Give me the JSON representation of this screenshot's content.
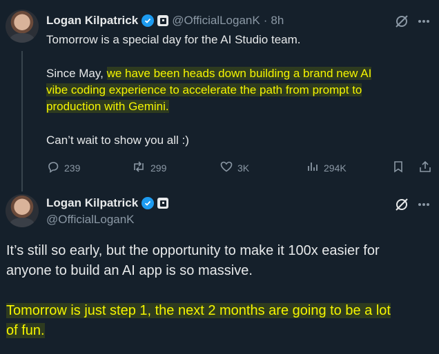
{
  "tweet1": {
    "author_name": "Logan Kilpatrick",
    "handle": "@OfficialLoganK",
    "separator": "·",
    "time": "8h",
    "paragraphs": [
      [
        "Tomorrow is a special day for the AI Studio team."
      ],
      [
        "Since May, ",
        "we have been heads down building a brand new AI"
      ],
      [
        "vibe coding experience to accelerate the path from prompt to"
      ],
      [
        "production with Gemini."
      ],
      [
        "Can’t wait to show you all :)"
      ]
    ],
    "stats": {
      "replies": "239",
      "reposts": "299",
      "likes": "3K",
      "views": "294K"
    }
  },
  "tweet2": {
    "author_name": "Logan Kilpatrick",
    "handle": "@OfficialLoganK",
    "lines": [
      "It’s still so early, but the opportunity to make it 100x easier for",
      "anyone to build an AI app is so massive.",
      "Tomorrow is just step 1, the next 2 months are going to be a lot",
      "of fun."
    ]
  },
  "icons": {
    "verified": "verified-badge-icon",
    "affiliate": "affiliate-badge-icon",
    "grok": "grok-icon",
    "more": "more-icon",
    "reply": "reply-icon",
    "repost": "repost-icon",
    "like": "like-icon",
    "views": "views-icon",
    "bookmark": "bookmark-icon",
    "share": "share-icon"
  },
  "colors": {
    "background": "#15202b",
    "text": "#e7e9ea",
    "muted": "#8b98a5",
    "verified": "#1d9bf0",
    "highlight": "#f5f500"
  }
}
